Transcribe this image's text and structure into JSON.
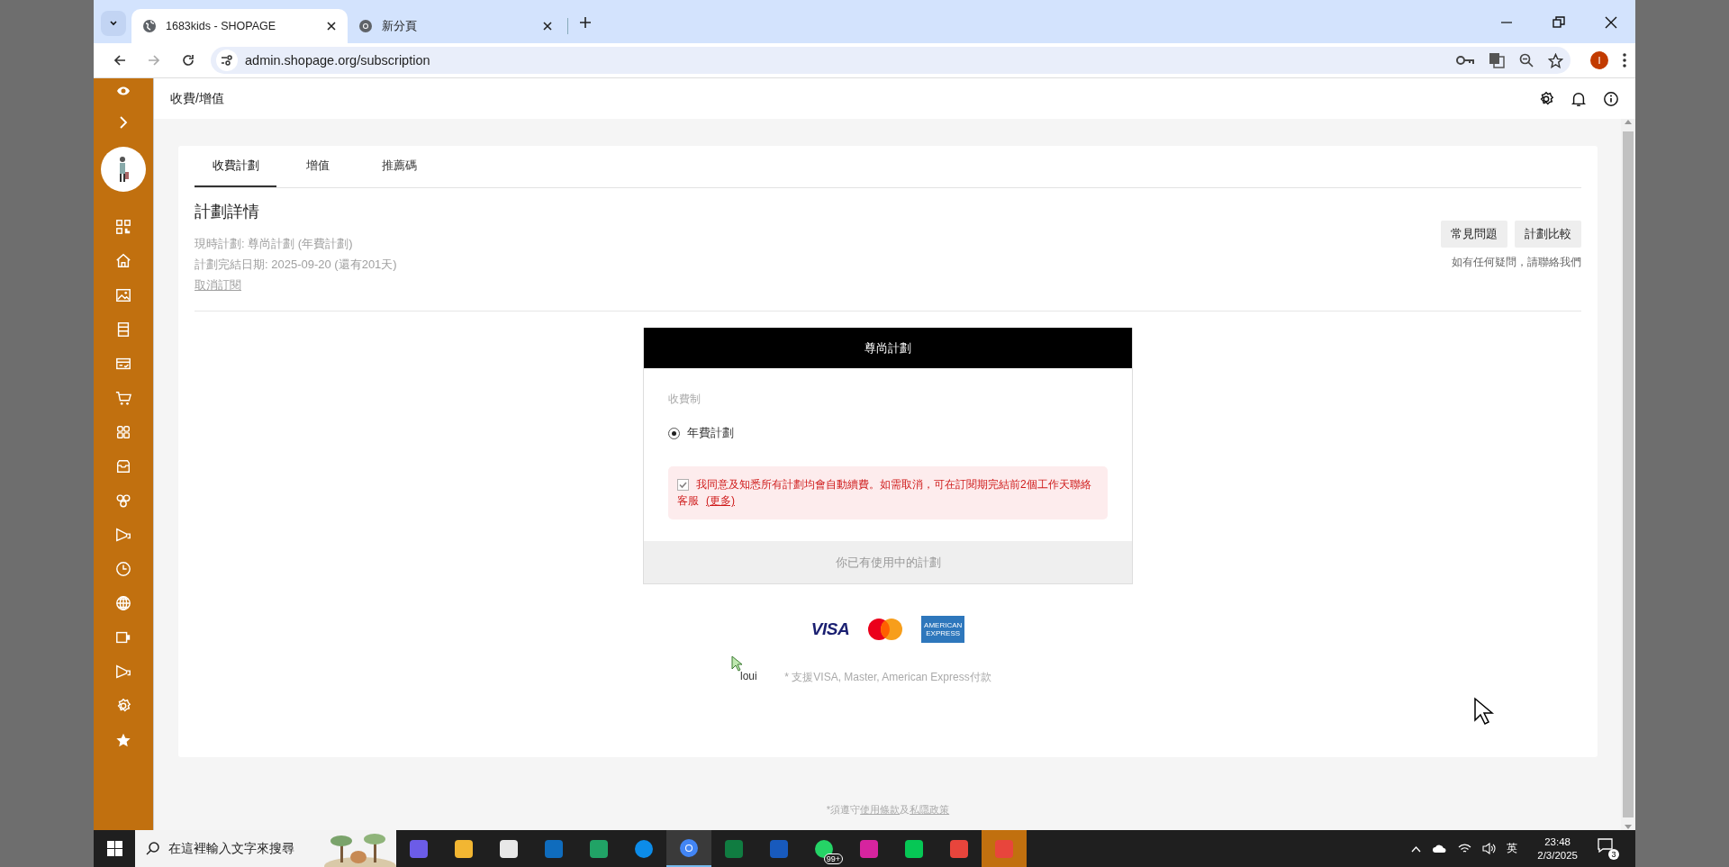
{
  "browser": {
    "tabs": [
      {
        "title": "1683kids - SHOPAGE",
        "selected": true
      },
      {
        "title": "新分頁",
        "selected": false
      }
    ],
    "url": "admin.shopage.org/subscription",
    "profile_initial": "I"
  },
  "page": {
    "breadcrumb": "收費/增值",
    "tabs": [
      {
        "label": "收費計劃",
        "selected": true
      },
      {
        "label": "增值",
        "selected": false
      },
      {
        "label": "推薦碼",
        "selected": false
      }
    ],
    "section_title": "計劃詳情",
    "current_plan": "現時計劃: 尊尚計劃 (年費計劃)",
    "end_date": "計劃完結日期: 2025-09-20 (還有201天)",
    "cancel_link": "取消訂閱",
    "buttons": [
      "常見問題",
      "計劃比較"
    ],
    "contact_note": "如有任何疑問，請聯絡我們",
    "plan_card": {
      "title": "尊尚計劃",
      "billing_label": "收費制",
      "options": [
        {
          "label": "年費計劃",
          "selected": true
        }
      ],
      "agreement": {
        "text": "我同意及知悉所有計劃均會自動續費。如需取消，可在訂閱期完結前2個工作天聯絡客服",
        "link": "(更多)",
        "checked": true,
        "disabled": true
      },
      "action": {
        "label": "你已有使用中的計劃",
        "disabled": true
      }
    },
    "payment_logos": [
      {
        "kind": "visa",
        "text": "VISA"
      },
      {
        "kind": "mastercard"
      },
      {
        "kind": "amex",
        "text": "AMERICAN EXPRESS"
      }
    ],
    "payment_note": "* 支援VISA, Master, American Express付款",
    "cursor_label": "loui",
    "footer": {
      "prefix": "*須遵守",
      "terms": "使用條款",
      "joiner": "及",
      "privacy": "私隱政策"
    }
  },
  "taskbar": {
    "search_placeholder": "在這裡輸入文字來搜尋",
    "badge": "99+",
    "input_method": "英",
    "time": "23:48",
    "date": "2/3/2025",
    "notifications": "3"
  }
}
